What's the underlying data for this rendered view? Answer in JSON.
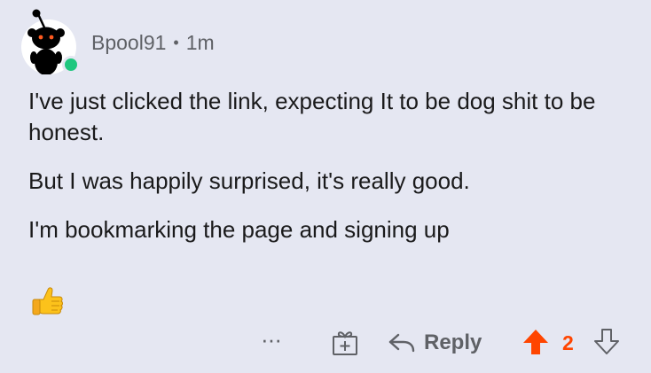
{
  "comment": {
    "author": "Bpool91",
    "separator": "•",
    "age": "1m",
    "avatar_online": true,
    "paragraphs": [
      "I've just clicked the link, expecting It to be dog shit to be honest.",
      "But I was happily surprised, it's really good.",
      "I'm bookmarking the page and signing up"
    ],
    "emoji_icon": "thumbs-up-emoji"
  },
  "actions": {
    "more_label": "···",
    "reply_label": "Reply",
    "vote_count": "2"
  },
  "colors": {
    "background": "#e5e7f2",
    "upvote_active": "#ff4500",
    "muted_text": "#5f6166",
    "online": "#1fc77e"
  }
}
